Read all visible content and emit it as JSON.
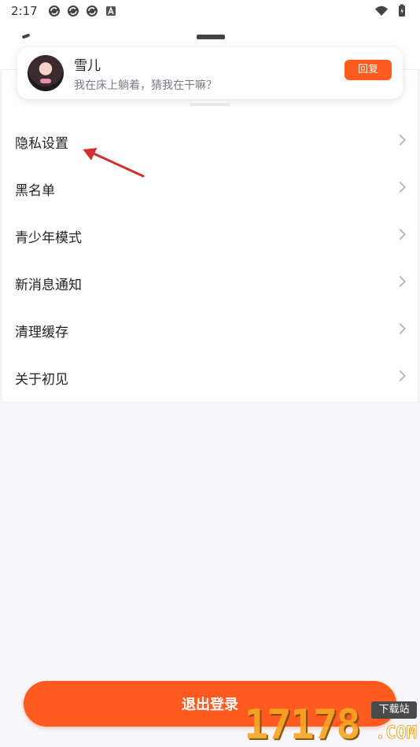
{
  "status_bar": {
    "time": "2:17"
  },
  "notification": {
    "sender_name": "雪儿",
    "message": "我在床上躺着，猜我在干嘛？",
    "reply_label": "回复"
  },
  "menu": {
    "items": [
      {
        "label": "隐私设置"
      },
      {
        "label": "黑名单"
      },
      {
        "label": "青少年模式"
      },
      {
        "label": "新消息通知"
      },
      {
        "label": "清理缓存"
      },
      {
        "label": "关于初见"
      }
    ]
  },
  "logout": {
    "label": "退出登录"
  },
  "watermark": {
    "digits": "17178",
    "badge": "下载站",
    "domain": ".COM"
  },
  "colors": {
    "accent": "#ff5a1f",
    "annotation_arrow": "#d0302e",
    "watermark": "#f5a623"
  },
  "icons": {
    "status_left": [
      "sync-icon",
      "sync-icon",
      "sync-icon",
      "a-badge-icon"
    ],
    "status_right": [
      "wifi-icon",
      "battery-icon"
    ]
  }
}
